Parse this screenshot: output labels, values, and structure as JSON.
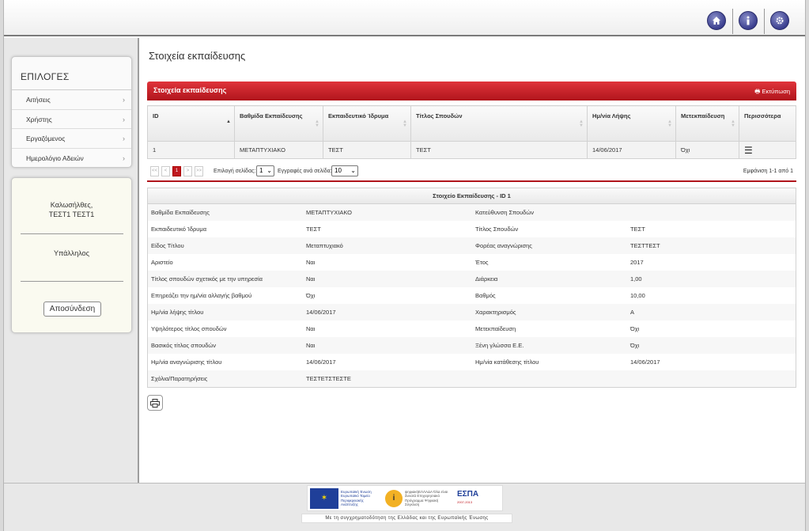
{
  "header": {
    "icons": [
      "home-icon",
      "info-icon",
      "settings-icon"
    ]
  },
  "sidebar": {
    "menu_title": "ΕΠΙΛΟΓΕΣ",
    "items": [
      {
        "label": "Αιτήσεις"
      },
      {
        "label": "Χρήστης"
      },
      {
        "label": "Εργαζόμενος"
      },
      {
        "label": "Ημερολόγιο Αδειών"
      }
    ],
    "user": {
      "greeting": "Καλωσήλθες,",
      "name": "ΤΕΣΤ1 ΤΕΣΤ1",
      "role": "Υπάλληλος",
      "logout": "Αποσύνδεση"
    }
  },
  "main": {
    "page_title": "Στοιχεία εκπαίδευσης",
    "panel_title": "Στοιχεία εκπαίδευσης",
    "print_label": "Εκτύπωση",
    "table": {
      "columns": [
        "ID",
        "Βαθμίδα Εκπαίδευσης",
        "Εκπαιδευτικό Ίδρυμα",
        "Τίτλος Σπουδών",
        "Ημ/νία Λήψης",
        "Μετεκπαίδευση",
        "Περισσότερα"
      ],
      "rows": [
        [
          "1",
          "ΜΕΤΑΠΤΥΧΙΑΚΟ",
          "ΤΕΣΤ",
          "ΤΕΣΤ",
          "14/06/2017",
          "Όχι",
          ""
        ]
      ]
    },
    "pager": {
      "first": "<<",
      "prev": "<",
      "current": "1",
      "next": ">",
      "last": ">>",
      "page_select_label": "Επιλογή σελίδας:",
      "page_value": "1",
      "per_page_label": "Εγγραφές ανά σελίδα:",
      "per_page_value": "10",
      "info": "Εμφάνιση 1-1 από 1"
    },
    "detail": {
      "title": "Στοιχείο Εκπαίδευσης - ID 1",
      "rows": [
        [
          "Βαθμίδα Εκπαίδευσης",
          "ΜΕΤΑΠΤΥΧΙΑΚΟ",
          "Κατεύθυνση Σπουδών",
          ""
        ],
        [
          "Εκπαιδευτικό Ίδρυμα",
          "ΤΕΣΤ",
          "Τίτλος Σπουδών",
          "ΤΕΣΤ"
        ],
        [
          "Είδος Τίτλου",
          "Μεταπτυχιακό",
          "Φορέας αναγνώρισης",
          "ΤΕΣΤΤΕΣΤ"
        ],
        [
          "Αριστείο",
          "Ναι",
          "Έτος",
          "2017"
        ],
        [
          "Τίτλος σπουδών σχετικός με την υπηρεσία",
          "Ναι",
          "Διάρκεια",
          "1,00"
        ],
        [
          "Επηρεάζει την ημ/νία αλλαγής βαθμού",
          "Όχι",
          "Βαθμός",
          "10,00"
        ],
        [
          "Ημ/νία λήψης τίτλου",
          "14/06/2017",
          "Χαρακτηρισμός",
          "Α"
        ],
        [
          "Υψηλότερος τίτλος σπουδών",
          "Ναι",
          "Μετεκπαίδευση",
          "Όχι"
        ],
        [
          "Βασικός τίτλος σπουδών",
          "Ναι",
          "Ξένη γλώσσα Ε.Ε.",
          "Όχι"
        ],
        [
          "Ημ/νία αναγνώρισης τίτλου",
          "14/06/2017",
          "Ημ/νία κατάθεσης τίτλου",
          "14/06/2017"
        ],
        [
          "Σχόλια/Παρατηρήσεις",
          "ΤΕΣΤΕΤΣΤΕΣΤΕ",
          "",
          ""
        ]
      ]
    }
  },
  "footer": {
    "eu_text": "Ευρωπαϊκή Ένωση Ευρωπαϊκό Ταμείο Περιφερειακής Ανάπτυξης",
    "digital_text": "ψηφιακήΕΛΛΑΔΑ Όλα είναι δυνατά Επιχειρησιακό Πρόγραμμα Ψηφιακή Σύγκλιση",
    "espa": "ΕΣΠΑ",
    "espa_years": "2007-2013",
    "funding_text": "Με τη συγχρηματοδότηση της Ελλάδας και της Ευρωπαϊκής Ένωσης"
  }
}
